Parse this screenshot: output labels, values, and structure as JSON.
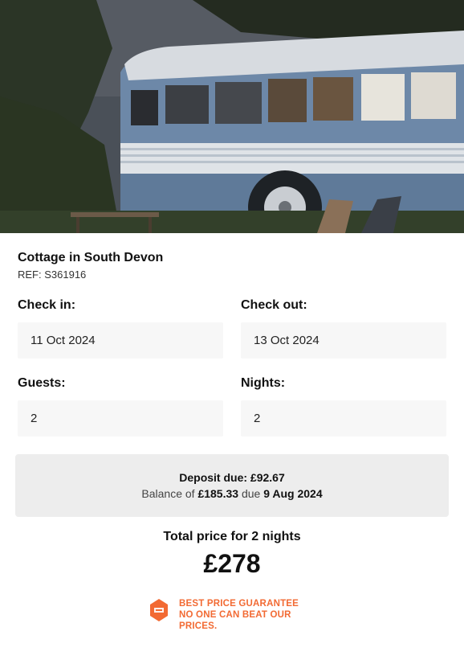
{
  "hero": {
    "image_icon": "vintage-bus-photo"
  },
  "property": {
    "title": "Cottage in South Devon",
    "ref": "REF: S361916"
  },
  "booking": {
    "check_in_label": "Check in:",
    "check_in_value": "11 Oct 2024",
    "check_out_label": "Check out:",
    "check_out_value": "13 Oct 2024",
    "guests_label": "Guests:",
    "guests_value": "2",
    "nights_label": "Nights:",
    "nights_value": "2"
  },
  "deposit": {
    "deposit_text": "Deposit due: £92.67",
    "balance_prefix": "Balance of ",
    "balance_amount": "£185.33",
    "balance_mid": " due ",
    "balance_date": "9 Aug 2024"
  },
  "pricing": {
    "total_label": "Total price for 2 nights",
    "total_value": "£278"
  },
  "guarantee": {
    "icon": "price-tag-badge-icon",
    "line1": "BEST PRICE GUARANTEE",
    "line2": "NO ONE CAN BEAT OUR",
    "line3": "PRICES.",
    "accent_color": "#f26a33"
  }
}
